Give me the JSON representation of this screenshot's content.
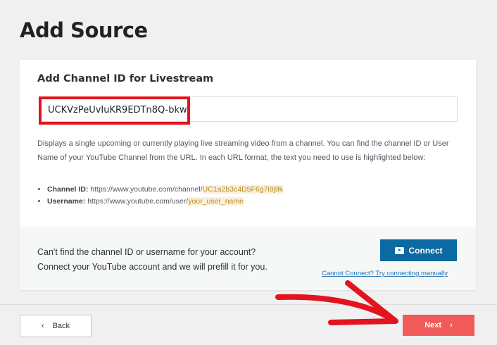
{
  "page_title": "Add Source",
  "card": {
    "title": "Add Channel ID for Livestream",
    "channel_input": "UCKVzPeUvIuKR9EDTn8Q-bkw",
    "description": "Displays a single upcoming or currently playing live streaming video from a channel. You can find the channel ID or User Name of your YouTube Channel from the URL. In each URL format, the text you need to use is highlighted below:",
    "formats": [
      {
        "label": "Channel ID:",
        "url": "https://www.youtube.com/channel/",
        "highlight": "UC1a2b3c4D5F6g7i8j9k"
      },
      {
        "label": "Username:",
        "url": "https://www.youtube.com/user/",
        "highlight": "your_user_name"
      }
    ],
    "help_line1": "Can't find the channel ID or username for your account?",
    "help_line2": "Connect your YouTube account and we will prefill it for you.",
    "connect_label": "Connect",
    "manual_link": "Cannot Connect? Try connecting manually"
  },
  "footer": {
    "back_label": "Back",
    "next_label": "Next",
    "back_icon": "‹",
    "next_icon": "›"
  },
  "colors": {
    "annotation": "#e3141e",
    "next": "#f05a59",
    "connect": "#0a6aa1"
  }
}
